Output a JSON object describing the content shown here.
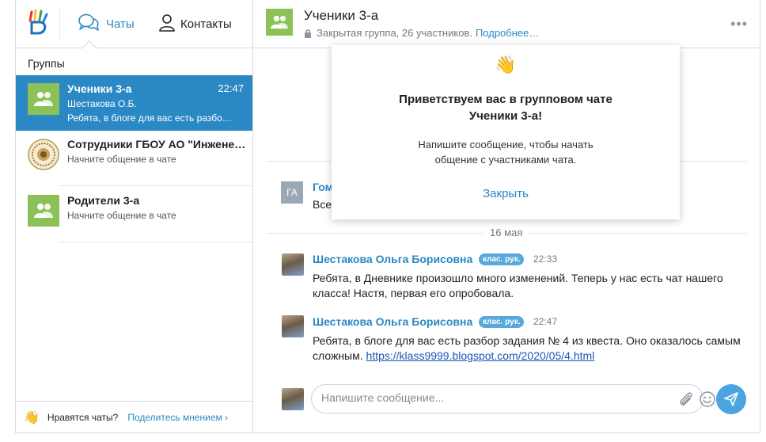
{
  "colors": {
    "accent": "#2a88c4",
    "active_bg": "#2a88c4",
    "group_avatar": "#8cc157",
    "badge": "#59a8dc"
  },
  "nav": {
    "chats_label": "Чаты",
    "contacts_label": "Контакты"
  },
  "sidebar": {
    "groups_label": "Группы",
    "chats": [
      {
        "title": "Ученики 3-а",
        "time": "22:47",
        "author": "Шестакова О.Б.",
        "preview": "Ребята, в блоге для вас есть разбо…",
        "avatar": "group"
      },
      {
        "title": "Сотрудники ГБОУ АО \"Инжене…",
        "preview": "Начните общение в чате",
        "avatar": "emblem"
      },
      {
        "title": "Родители 3-а",
        "preview": "Начните общение в чате",
        "avatar": "group"
      }
    ],
    "footer": {
      "question": "Нравятся чаты?",
      "share_label": "Поделитесь мнением ›"
    }
  },
  "chat_header": {
    "title": "Ученики 3-а",
    "subtitle": "Закрытая группа, 26 участников.",
    "more_label": "Подробнее…",
    "menu_icon": "more-dots-icon"
  },
  "messages": {
    "first": {
      "initials": "ГА",
      "author": "Гоман",
      "text": "Всем п"
    },
    "date_separator": "16 мая",
    "items": [
      {
        "author": "Шестакова Ольга Борисовна",
        "badge": "клас. рук.",
        "time": "22:33",
        "text": "Ребята, в Дневнике произошло много изменений. Теперь у нас есть чат нашего класса! Настя, первая его опробовала."
      },
      {
        "author": "Шестакова Ольга Борисовна",
        "badge": "клас. рук.",
        "time": "22:47",
        "text": "Ребята, в блоге для вас есть разбор задания № 4 из квеста. Оно оказалось самым сложным.",
        "link": "https://klass9999.blogspot.com/2020/05/4.html"
      }
    ]
  },
  "composer": {
    "placeholder": "Напишите сообщение..."
  },
  "popup": {
    "emoji": "👋",
    "heading_line1": "Приветствуем вас в групповом чате",
    "heading_line2": "Ученики 3-а!",
    "text_line1": "Напишите сообщение, чтобы начать",
    "text_line2": "общение с участниками чата.",
    "close_label": "Закрыть"
  }
}
